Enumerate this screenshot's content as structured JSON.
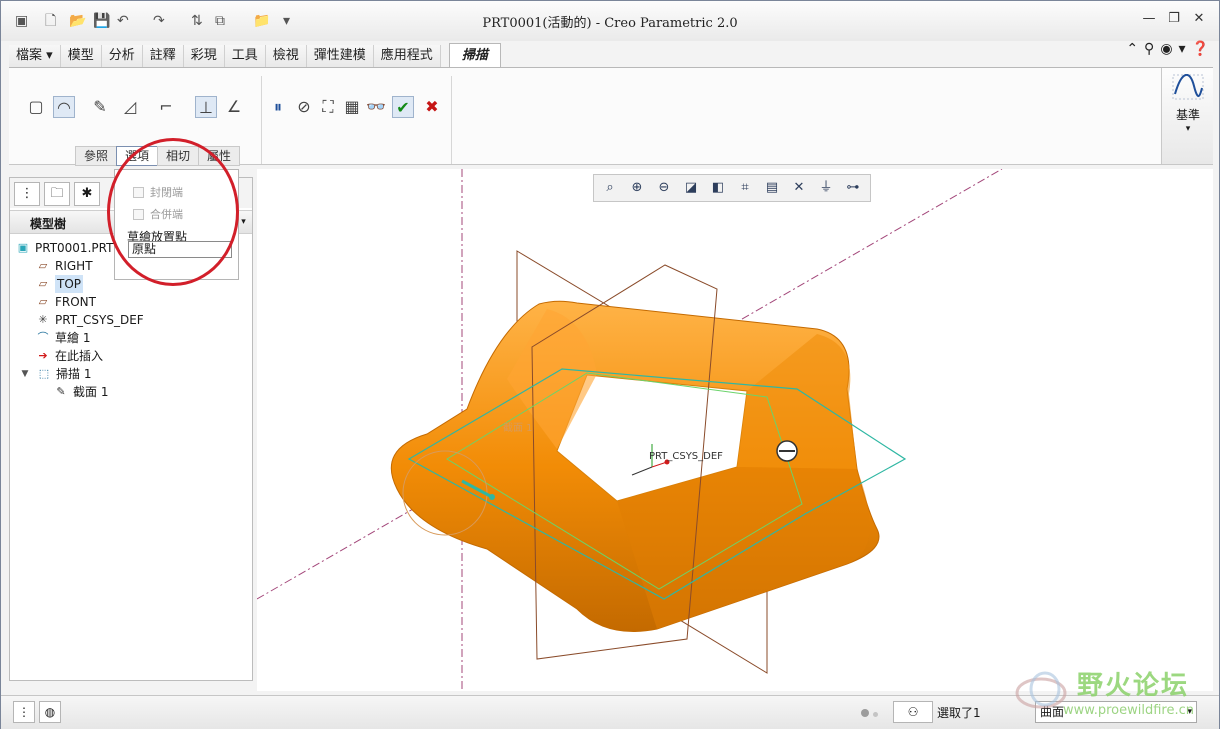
{
  "window": {
    "title": "PRT0001(活動的) - Creo Parametric 2.0",
    "minimize_icon": "minimize-icon",
    "maximize_icon": "maximize-icon",
    "close_icon": "close-icon"
  },
  "ribbon": {
    "tabs": [
      "檔案",
      "模型",
      "分析",
      "註釋",
      "彩現",
      "工具",
      "檢視",
      "彈性建模",
      "應用程式"
    ],
    "active_tab": "掃描",
    "subtabs": [
      "參照",
      "選項",
      "相切",
      "屬性"
    ],
    "datum_group_label": "基準"
  },
  "options_panel": {
    "closed_ends_label": "封閉端",
    "merge_ends_label": "合併端",
    "sketch_placement_label": "草繪放置點",
    "sketch_placement_value": "原點"
  },
  "model_tree": {
    "header": "模型樹",
    "items": [
      {
        "label": "PRT0001.PRT",
        "icon": "part-icon"
      },
      {
        "label": "RIGHT",
        "icon": "datum-plane-icon"
      },
      {
        "label": "TOP",
        "icon": "datum-plane-icon"
      },
      {
        "label": "FRONT",
        "icon": "datum-plane-icon"
      },
      {
        "label": "PRT_CSYS_DEF",
        "icon": "csys-icon"
      },
      {
        "label": "草繪 1",
        "icon": "sketch-icon"
      },
      {
        "label": "在此插入",
        "icon": "insert-here-icon"
      },
      {
        "label": "掃描 1",
        "icon": "sweep-icon"
      },
      {
        "label": "截面 1",
        "icon": "section-icon"
      }
    ]
  },
  "viewport": {
    "csys_label": "PRT_CSYS_DEF",
    "section_label": "截面 1",
    "model_color": "#f28c06",
    "datum_color": "#8a4b2a",
    "trajectory_color": "#2fb7a3"
  },
  "statusbar": {
    "selection_text": "選取了1",
    "filter_value": "曲面"
  },
  "watermark": {
    "title": "野火论坛",
    "url": "www.proewildfire.cn"
  }
}
